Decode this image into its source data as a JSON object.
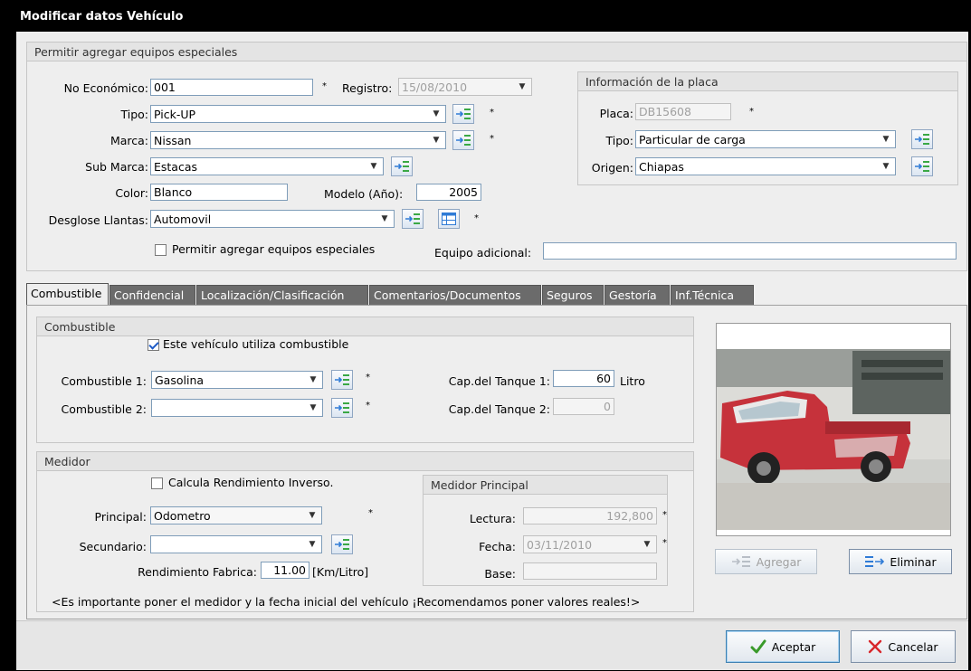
{
  "window": {
    "title": "Modificar datos Vehículo"
  },
  "top_group": {
    "title": "Permitir agregar equipos especiales"
  },
  "vehicle": {
    "no_economico_label": "No Económico:",
    "no_economico_value": "001",
    "registro_label": "Registro:",
    "registro_value": "15/08/2010",
    "tipo_label": "Tipo:",
    "tipo_value": "Pick-UP",
    "marca_label": "Marca:",
    "marca_value": "Nissan",
    "submarca_label": "Sub Marca:",
    "submarca_value": "Estacas",
    "color_label": "Color:",
    "color_value": "Blanco",
    "modelo_label": "Modelo (Año):",
    "modelo_value": "2005",
    "llantas_label": "Desglose Llantas:",
    "llantas_value": "Automovil",
    "equipos_checkbox_label": "Permitir agregar equipos especiales",
    "equipo_adicional_label": "Equipo adicional:",
    "equipo_adicional_value": "",
    "required_mark": "*"
  },
  "placa": {
    "title": "Información de la placa",
    "placa_label": "Placa:",
    "placa_value": "DB15608",
    "tipo_label": "Tipo:",
    "tipo_value": "Particular de carga",
    "origen_label": "Origen:",
    "origen_value": "Chiapas"
  },
  "tabs": [
    {
      "label": "Combustible"
    },
    {
      "label": "Confidencial"
    },
    {
      "label": "Localización/Clasificación"
    },
    {
      "label": "Comentarios/Documentos"
    },
    {
      "label": "Seguros"
    },
    {
      "label": "Gestoría"
    },
    {
      "label": "Inf.Técnica"
    }
  ],
  "combustible": {
    "title": "Combustible",
    "uses_fuel_label": "Este vehículo utiliza combustible",
    "comb1_label": "Combustible 1:",
    "comb1_value": "Gasolina",
    "comb2_label": "Combustible 2:",
    "comb2_value": "",
    "tank1_label": "Cap.del Tanque 1:",
    "tank1_value": "60",
    "tank1_unit": "Litro",
    "tank2_label": "Cap.del Tanque 2:",
    "tank2_value": "0"
  },
  "medidor": {
    "title": "Medidor",
    "inverse_label": "Calcula Rendimiento Inverso.",
    "principal_label": "Principal:",
    "principal_value": "Odometro",
    "secundario_label": "Secundario:",
    "secundario_value": "",
    "rendimiento_label": "Rendimiento Fabrica:",
    "rendimiento_value": "11.00",
    "rendimiento_unit": "[Km/Litro]",
    "note": "<Es importante poner el medidor y la fecha inicial del vehículo  ¡Recomendamos poner valores reales!>"
  },
  "medidor_principal": {
    "title": "Medidor Principal",
    "lectura_label": "Lectura:",
    "lectura_value": "192,800",
    "fecha_label": "Fecha:",
    "fecha_value": "03/11/2010",
    "base_label": "Base:",
    "base_value": ""
  },
  "photo_buttons": {
    "agregar": "Agregar",
    "eliminar": "Eliminar"
  },
  "dialog_buttons": {
    "aceptar": "Aceptar",
    "cancelar": "Cancelar"
  },
  "colors": {
    "tab_inactive": "#6b6b6b",
    "accent_ok": "#3a9a2a",
    "cancel_x": "#d8262b",
    "icon_blue": "#2f7bd6",
    "icon_green": "#3aa845"
  }
}
